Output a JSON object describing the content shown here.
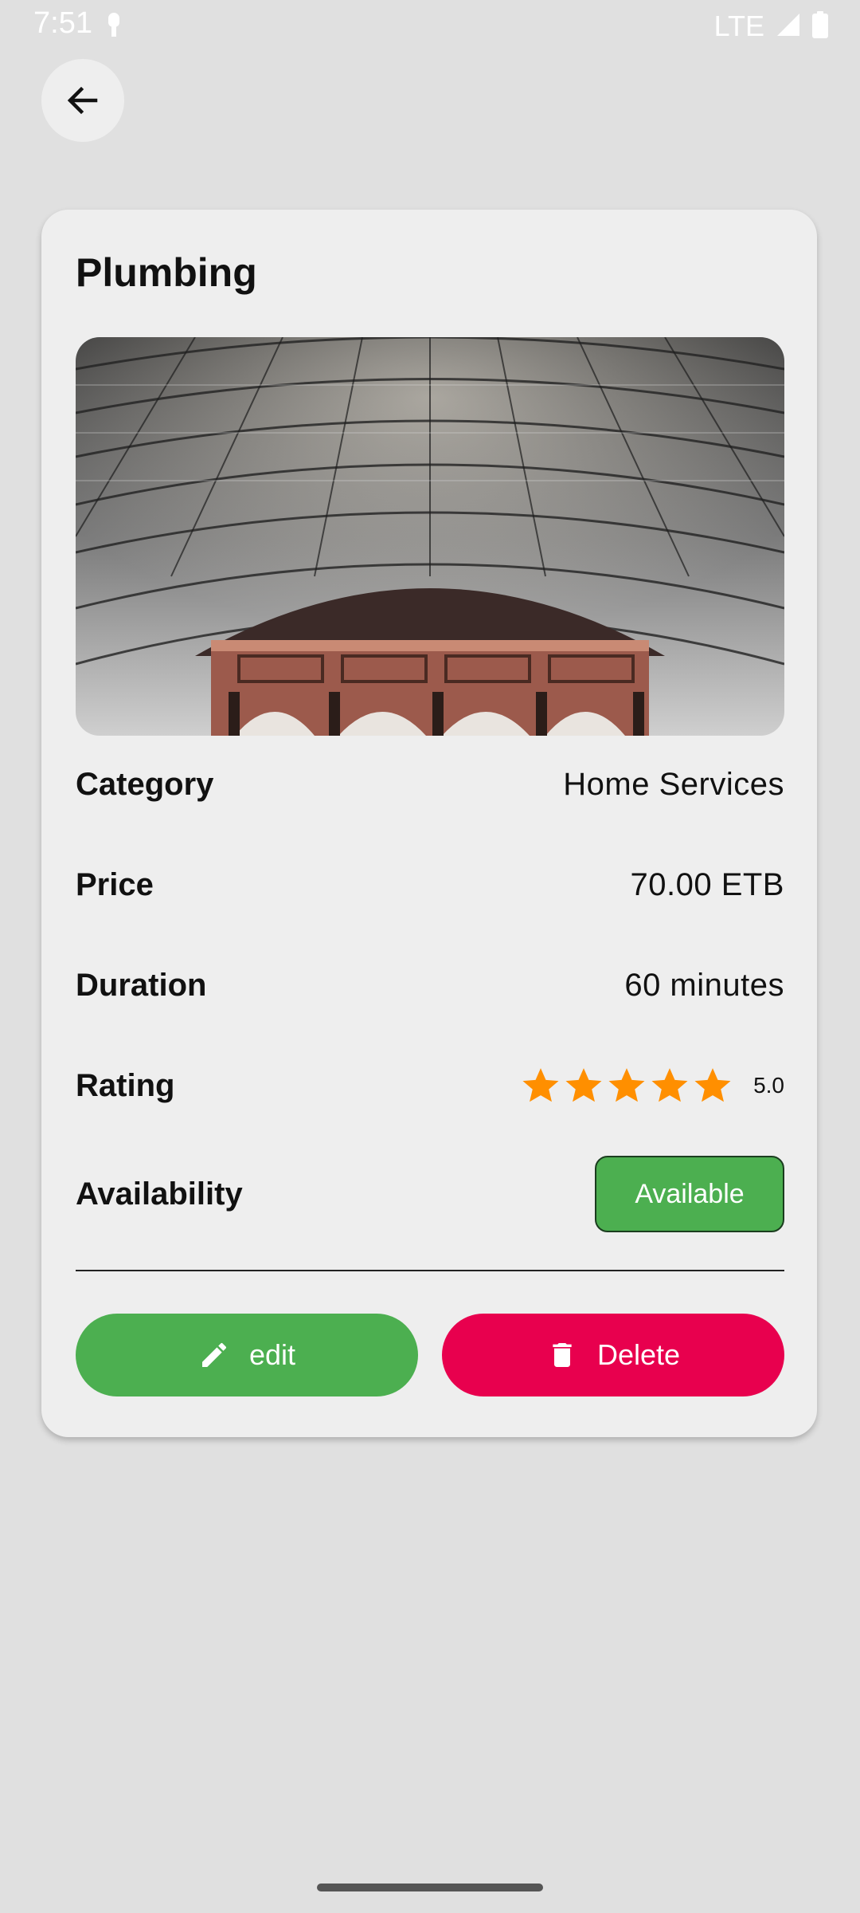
{
  "status_bar": {
    "time": "7:51",
    "network": "LTE"
  },
  "service": {
    "title": "Plumbing",
    "image_icon": "building-roof-photo",
    "details": [
      {
        "label": "Category",
        "value": "Home Services"
      },
      {
        "label": "Price",
        "value": "70.00 ETB"
      },
      {
        "label": "Duration",
        "value": "60 minutes"
      }
    ],
    "rating": {
      "label": "Rating",
      "value": "5.0",
      "stars": 5,
      "star_color": "#ff8f00"
    },
    "availability": {
      "label": "Availability",
      "status": "Available",
      "color": "#4caf50"
    }
  },
  "actions": {
    "edit_label": "edit",
    "edit_icon": "pencil-icon",
    "edit_color": "#4caf50",
    "delete_label": "Delete",
    "delete_icon": "trash-icon",
    "delete_color": "#e8004e"
  }
}
